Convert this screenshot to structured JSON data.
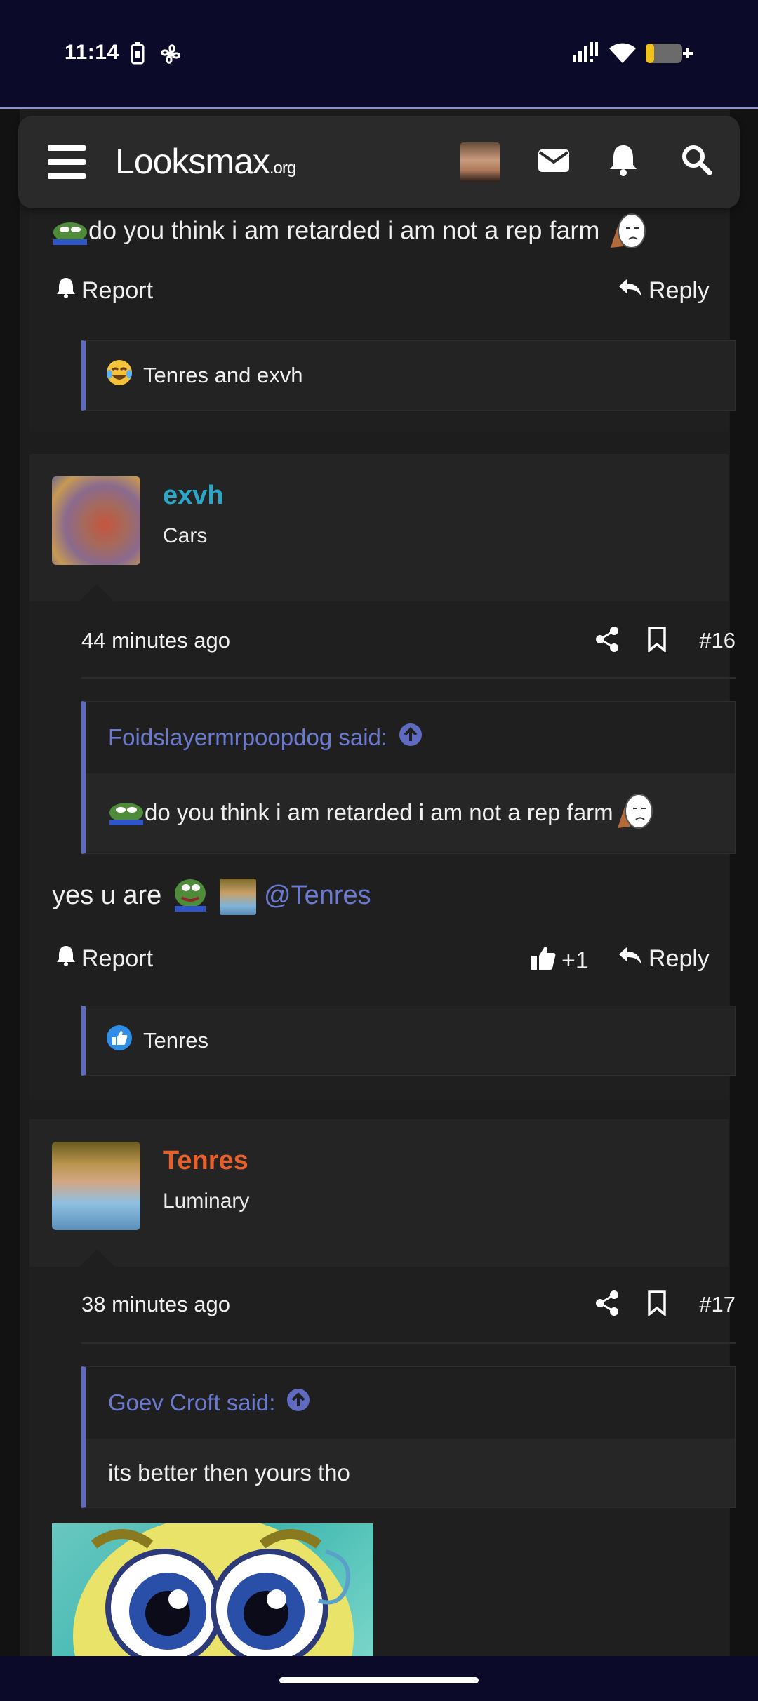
{
  "status_bar": {
    "time": "11:14"
  },
  "navbar": {
    "logo_main": "Looksmax",
    "logo_suffix": ".org"
  },
  "post15": {
    "body_text": "do you think i am retarded i am not a rep farm",
    "report_label": "Report",
    "reply_label": "Reply",
    "reactions_text": "Tenres and exvh"
  },
  "post16": {
    "username": "exvh",
    "username_color": "#2aa7c9",
    "user_title": "Cars",
    "time": "44 minutes ago",
    "post_number": "#16",
    "quote_author": "Foidslayermrpoopdog said:",
    "quote_text": "do you think i am retarded i am not a rep farm",
    "body_text": "yes u are",
    "mention": "@Tenres",
    "report_label": "Report",
    "like_count": "+1",
    "reply_label": "Reply",
    "reactions_text": "Tenres"
  },
  "post17": {
    "username": "Tenres",
    "username_color": "#e8602c",
    "user_title": "Luminary",
    "time": "38 minutes ago",
    "post_number": "#17",
    "quote_author": "Goev Croft said:",
    "quote_text": "its better then yours tho"
  },
  "colors": {
    "accent": "#5f6bc0",
    "status_bar_bg": "#0c0a29"
  }
}
